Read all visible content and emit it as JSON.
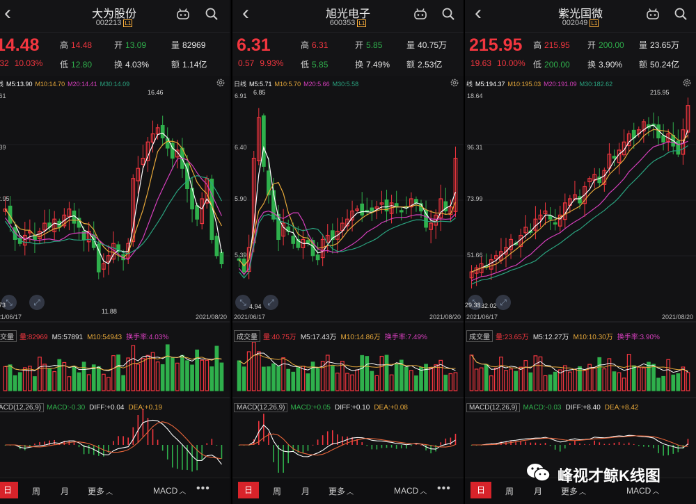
{
  "watermark": {
    "text": "峰视才鲸K线图"
  },
  "common": {
    "back_icon": "chevron-left-icon",
    "robot_icon": "robot-icon",
    "search_icon": "search-icon",
    "settings_icon": "gear-icon",
    "tabs": {
      "day": "日",
      "week": "周",
      "month": "月",
      "more": "更多",
      "indicator": "MACD",
      "dots": "•••"
    },
    "volume_label": "成交量",
    "kline_label": "日线"
  },
  "panels": [
    {
      "name": "大为股份",
      "code": "002213",
      "tag": "L1",
      "price": "14.48",
      "change": ".32",
      "change_pct": "10.03%",
      "high_label": "高",
      "high": "14.48",
      "low_label": "低",
      "low": "12.80",
      "open_label": "开",
      "open": "13.09",
      "turnover_label": "换",
      "turnover": "4.03%",
      "vol_label": "量",
      "vol": "82969",
      "amount_label": "额",
      "amount": "1.14亿",
      "kline_label": "线",
      "ma": {
        "m5": "M5:13.90",
        "m10": "M10:14.70",
        "m20": "M20:14.41",
        "m30": "M30:14.09"
      },
      "yticks": [
        ".61",
        ".39",
        "2.95"
      ],
      "price_annot_high": "16.46",
      "price_annot_low": "11.88",
      "left_tag": "73",
      "date_start": "21/06/17",
      "date_end": "2021/08/20",
      "vol_legend": {
        "label": "成交量",
        "vol": "量:82969",
        "m5": "M5:57891",
        "m10": "M10:54943",
        "turn": "换手率:4.03%"
      },
      "macd": {
        "label": "ACD(12,26,9)",
        "macd": "MACD:-0.30",
        "diff": "DIFF:+0.04",
        "dea": "DEA:+0.19"
      }
    },
    {
      "name": "旭光电子",
      "code": "600353",
      "tag": "L1",
      "price": "6.31",
      "change": "0.57",
      "change_pct": "9.93%",
      "high_label": "高",
      "high": "6.31",
      "low_label": "低",
      "low": "5.85",
      "open_label": "开",
      "open": "5.85",
      "turnover_label": "换",
      "turnover": "7.49%",
      "vol_label": "量",
      "vol": "40.75万",
      "amount_label": "额",
      "amount": "2.53亿",
      "kline_label": "日线",
      "ma": {
        "m5": "M5:5.71",
        "m10": "M10:5.70",
        "m20": "M20:5.66",
        "m30": "M30:5.58"
      },
      "yticks": [
        "6.91",
        "6.40",
        "5.90",
        "5.39"
      ],
      "price_annot_high": "6.85",
      "price_annot_low": "4.94",
      "date_start": "2021/06/17",
      "date_end": "2021/08/20",
      "vol_legend": {
        "label": "成交量",
        "vol": "量:40.75万",
        "m5": "M5:17.43万",
        "m10": "M10:14.86万",
        "turn": "换手率:7.49%"
      },
      "macd": {
        "label": "MACD(12,26,9)",
        "macd": "MACD:+0.05",
        "diff": "DIFF:+0.10",
        "dea": "DEA:+0.08"
      }
    },
    {
      "name": "紫光国微",
      "code": "002049",
      "tag": "L1",
      "price": "215.95",
      "change": "19.63",
      "change_pct": "10.00%",
      "high_label": "高",
      "high": "215.95",
      "low_label": "低",
      "low": "200.00",
      "open_label": "开",
      "open": "200.00",
      "turnover_label": "换",
      "turnover": "3.90%",
      "vol_label": "量",
      "vol": "23.65万",
      "amount_label": "额",
      "amount": "50.24亿",
      "kline_label": "线",
      "ma": {
        "m5": "M5:194.37",
        "m10": "M10:195.03",
        "m20": "M20:191.09",
        "m30": "M30:182.62"
      },
      "yticks": [
        "18.64",
        "96.31",
        "73.99",
        "51.66"
      ],
      "price_annot_high": "215.95",
      "price_annot_low": "132.02",
      "left_tag": "29.33",
      "date_start": "2021/06/17",
      "date_end": "2021/08/20",
      "vol_legend": {
        "label": "成交量",
        "vol": "量:23.65万",
        "m5": "M5:12.27万",
        "m10": "M10:10.30万",
        "turn": "换手率:3.90%"
      },
      "macd": {
        "label": "MACD(12,26,9)",
        "macd": "MACD:-0.03",
        "diff": "DIFF:+8.40",
        "dea": "DEA:+8.42"
      }
    }
  ]
}
